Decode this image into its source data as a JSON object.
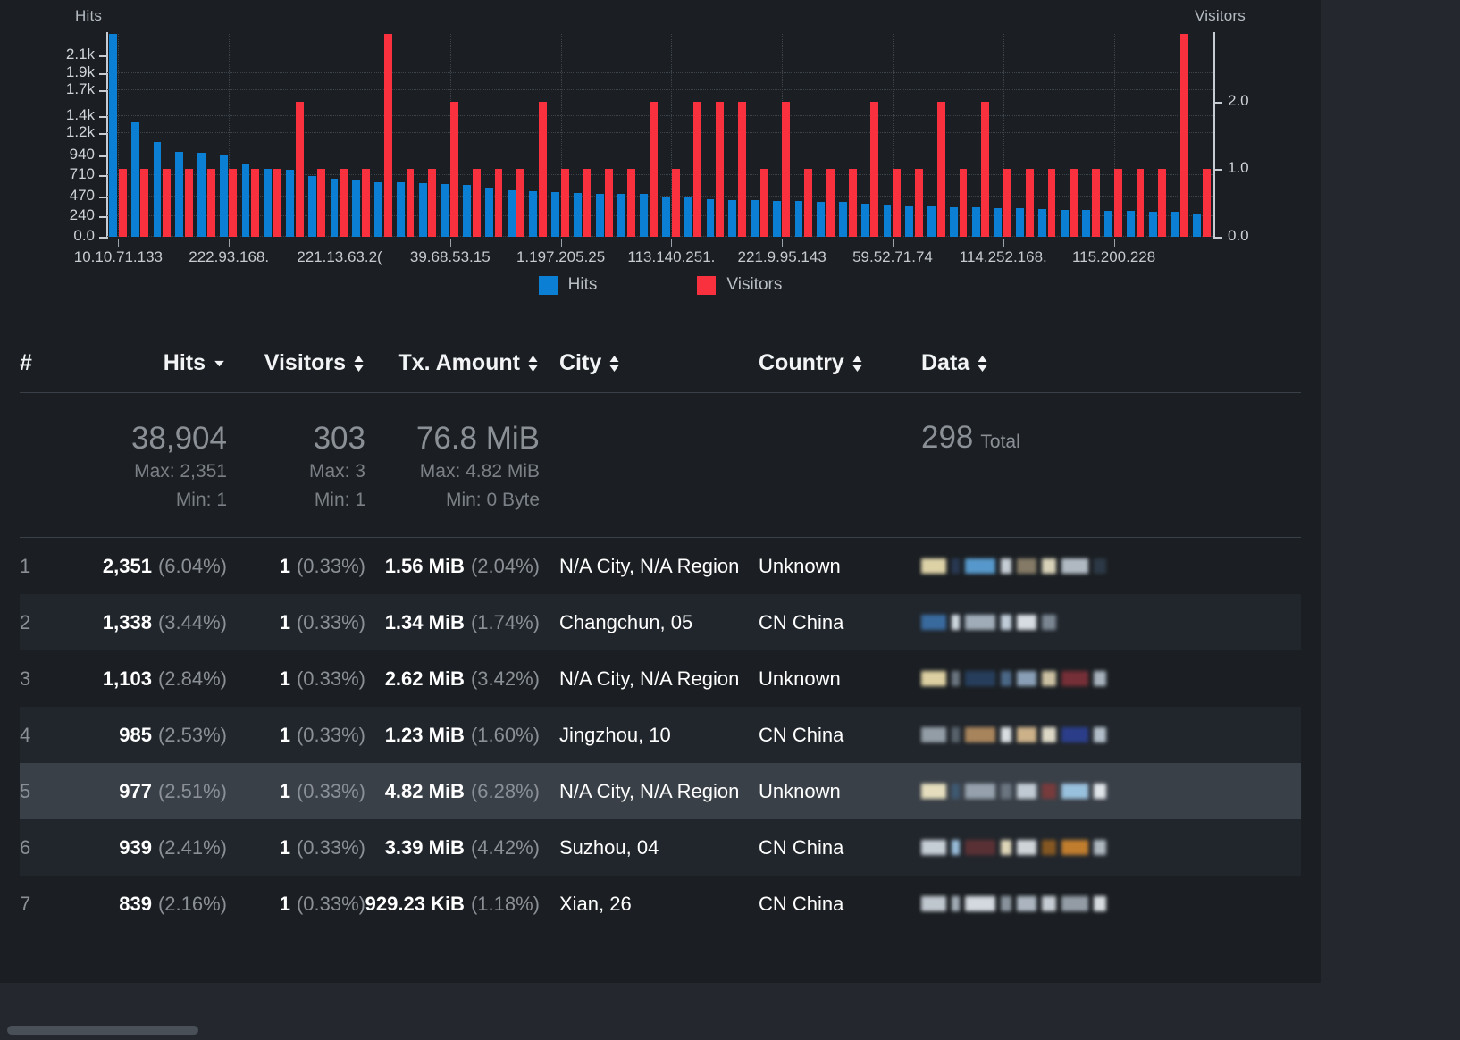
{
  "chart_data": {
    "type": "bar",
    "title": "",
    "ylabel": "Hits",
    "y2label": "Visitors",
    "xlabel": "",
    "grid": true,
    "legend_position": "bottom",
    "legend": [
      "Hits",
      "Visitors"
    ],
    "colors": {
      "hits": "#0a7fd4",
      "visitors": "#f9313f"
    },
    "yticks_left": [
      "0.0",
      "240",
      "470",
      "710",
      "940",
      "1.2k",
      "1.4k",
      "1.7k",
      "1.9k",
      "2.1k"
    ],
    "ytick_values_left": [
      0,
      240,
      470,
      710,
      940,
      1200,
      1400,
      1700,
      1900,
      2100
    ],
    "ylim": [
      0,
      2351
    ],
    "yticks_right": [
      "0.0",
      "1.0",
      "2.0"
    ],
    "ytick_values_right": [
      0,
      1,
      2
    ],
    "y2lim": [
      0,
      3
    ],
    "xtick_labels": [
      "10.10.71.133",
      "222.93.168.",
      "221.13.63.2(",
      "39.68.53.15",
      "1.197.205.25",
      "113.140.251.",
      "221.9.95.143",
      "59.52.71.74",
      "114.252.168.",
      "115.200.228"
    ],
    "series": [
      {
        "name": "Hits",
        "color": "#0a7fd4",
        "values": [
          2351,
          1338,
          1103,
          985,
          977,
          939,
          839,
          790,
          775,
          700,
          672,
          665,
          636,
          632,
          620,
          610,
          600,
          565,
          540,
          530,
          520,
          505,
          500,
          500,
          495,
          470,
          455,
          430,
          425,
          420,
          415,
          410,
          405,
          400,
          380,
          365,
          355,
          350,
          345,
          340,
          335,
          330,
          320,
          315,
          310,
          305,
          300,
          295,
          290,
          260
        ]
      },
      {
        "name": "Visitors",
        "color": "#f9313f",
        "values": [
          1,
          1,
          1,
          1,
          1,
          1,
          1,
          1,
          2,
          1,
          1,
          1,
          3,
          1,
          1,
          2,
          1,
          1,
          1,
          2,
          1,
          1,
          1,
          1,
          2,
          1,
          2,
          2,
          2,
          1,
          2,
          1,
          1,
          1,
          2,
          1,
          1,
          2,
          1,
          2,
          1,
          1,
          1,
          1,
          1,
          1,
          1,
          1,
          3,
          1
        ]
      }
    ]
  },
  "table": {
    "headers": [
      {
        "label": "#",
        "sort": "none"
      },
      {
        "label": "Hits",
        "sort": "desc"
      },
      {
        "label": "Visitors",
        "sort": "both"
      },
      {
        "label": "Tx. Amount",
        "sort": "both"
      },
      {
        "label": "City",
        "sort": "both"
      },
      {
        "label": "Country",
        "sort": "both"
      },
      {
        "label": "Data",
        "sort": "both"
      }
    ],
    "summary": {
      "hits_total": "38,904",
      "hits_max": "Max: 2,351",
      "hits_min": "Min: 1",
      "visitors_total": "303",
      "visitors_max": "Max: 3",
      "visitors_min": "Min: 1",
      "tx_total": "76.8 MiB",
      "tx_max": "Max: 4.82 MiB",
      "tx_min": "Min: 0 Byte",
      "data_count": "298",
      "data_count_label": "Total"
    },
    "rows": [
      {
        "rank": "1",
        "hits": "2,351",
        "hits_pct": "(6.04%)",
        "visitors": "1",
        "visitors_pct": "(0.33%)",
        "tx": "1.56 MiB",
        "tx_pct": "(2.04%)",
        "city": "N/A City, N/A Region",
        "country": "Unknown",
        "data": "redacted-ip"
      },
      {
        "rank": "2",
        "hits": "1,338",
        "hits_pct": "(3.44%)",
        "visitors": "1",
        "visitors_pct": "(0.33%)",
        "tx": "1.34 MiB",
        "tx_pct": "(1.74%)",
        "city": "Changchun, 05",
        "country": "CN China",
        "data": "redacted-ip"
      },
      {
        "rank": "3",
        "hits": "1,103",
        "hits_pct": "(2.84%)",
        "visitors": "1",
        "visitors_pct": "(0.33%)",
        "tx": "2.62 MiB",
        "tx_pct": "(3.42%)",
        "city": "N/A City, N/A Region",
        "country": "Unknown",
        "data": "redacted-ip"
      },
      {
        "rank": "4",
        "hits": "985",
        "hits_pct": "(2.53%)",
        "visitors": "1",
        "visitors_pct": "(0.33%)",
        "tx": "1.23 MiB",
        "tx_pct": "(1.60%)",
        "city": "Jingzhou, 10",
        "country": "CN China",
        "data": "redacted-ip"
      },
      {
        "rank": "5",
        "hits": "977",
        "hits_pct": "(2.51%)",
        "visitors": "1",
        "visitors_pct": "(0.33%)",
        "tx": "4.82 MiB",
        "tx_pct": "(6.28%)",
        "city": "N/A City, N/A Region",
        "country": "Unknown",
        "data": "redacted-ip"
      },
      {
        "rank": "6",
        "hits": "939",
        "hits_pct": "(2.41%)",
        "visitors": "1",
        "visitors_pct": "(0.33%)",
        "tx": "3.39 MiB",
        "tx_pct": "(4.42%)",
        "city": "Suzhou, 04",
        "country": "CN China",
        "data": "redacted-ip"
      },
      {
        "rank": "7",
        "hits": "839",
        "hits_pct": "(2.16%)",
        "visitors": "1",
        "visitors_pct": "(0.33%)",
        "tx": "929.23 KiB",
        "tx_pct": "(1.18%)",
        "city": "Xian, 26",
        "country": "CN China",
        "data": "redacted-ip"
      }
    ]
  }
}
